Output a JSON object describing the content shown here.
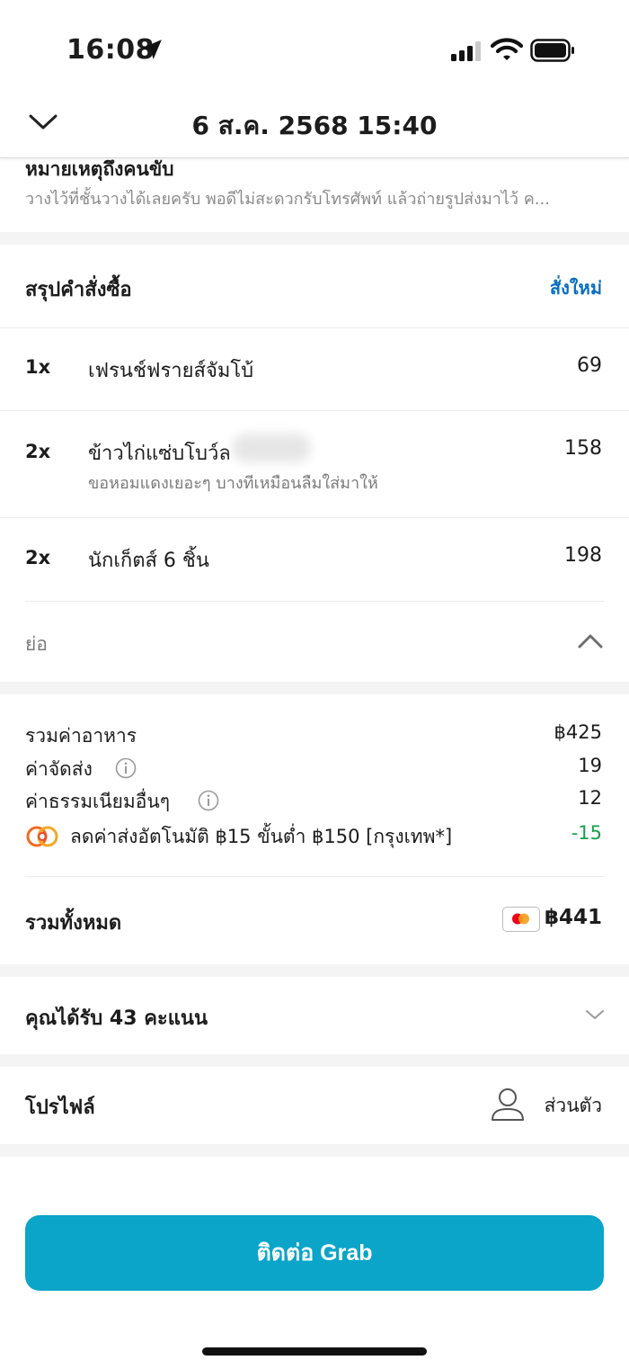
{
  "status_bar": {
    "time": "16:08"
  },
  "header": {
    "title": "6 ส.ค. 2568 15:40"
  },
  "driver_note": {
    "title": "หมายเหตุถึงคนขับ",
    "text": "วางไว้ที่ชั้นวางได้เลยครับ พอดีไม่สะดวกรับโทรศัพท์ แล้วถ่ายรูปส่งมาไว้ ค..."
  },
  "order_summary": {
    "title": "สรุปคำสั่งซื้อ",
    "reorder_label": "สั่งใหม่",
    "items": [
      {
        "qty": "1x",
        "name": "เฟรนช์ฟรายส์จัมโบ้",
        "note": "",
        "price": "69"
      },
      {
        "qty": "2x",
        "name": "ข้าวไก่แซ่บโบว์ล",
        "note": "ขอหอมแดงเยอะๆ บางทีเหมือนลืมใส่มาให้",
        "price": "158"
      },
      {
        "qty": "2x",
        "name": "นักเก็ตส์ 6 ชิ้น",
        "note": "",
        "price": "198"
      }
    ],
    "collapse_label": "ย่อ"
  },
  "fees": {
    "food_total_label": "รวมค่าอาหาร",
    "food_total_value": "฿425",
    "delivery_label": "ค่าจัดส่ง",
    "delivery_value": "19",
    "other_fees_label": "ค่าธรรมเนียมอื่นๆ",
    "other_fees_value": "12",
    "promo_label": "ลดค่าส่งอัตโนมัติ ฿15 ขั้นต่ำ ฿150 [กรุงเทพ*]",
    "promo_value": "-15"
  },
  "total": {
    "label": "รวมทั้งหมด",
    "value": "฿441"
  },
  "points": {
    "label": "คุณได้รับ 43 คะแนน"
  },
  "profile": {
    "label": "โปรไฟล์",
    "value": "ส่วนตัว"
  },
  "contact_button": {
    "label": "ติดต่อ Grab"
  },
  "colors": {
    "accent": "#0aa5c9",
    "link": "#0a6fc2",
    "discount": "#1e9e4a"
  }
}
